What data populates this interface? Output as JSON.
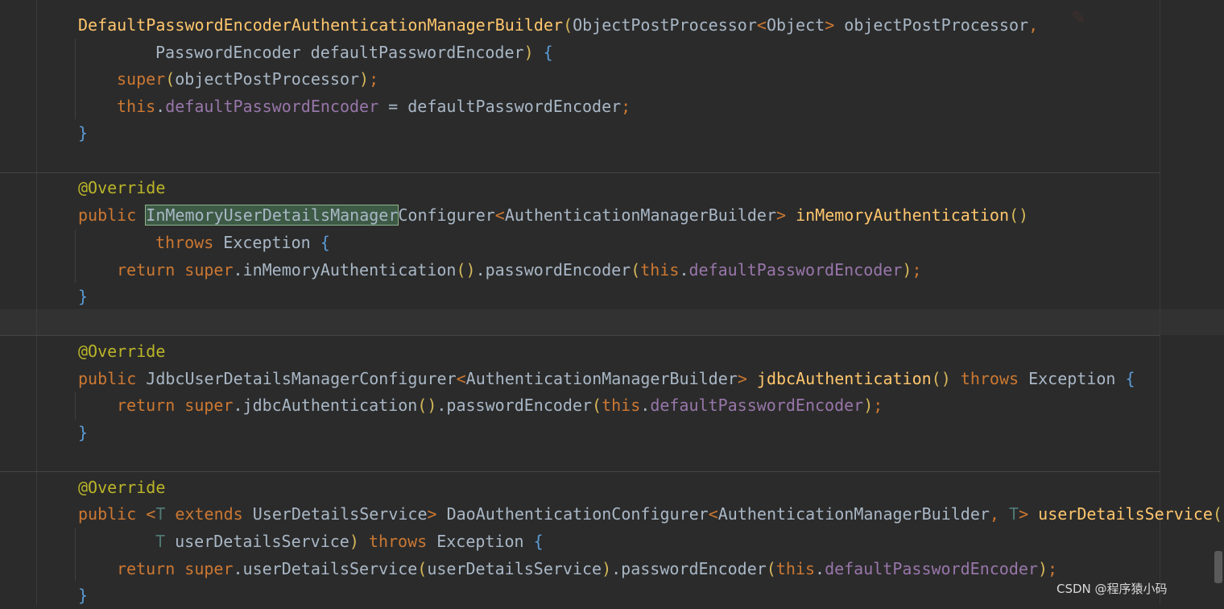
{
  "code": {
    "l0": "DefaultPasswordEncoderAuthenticationManagerBuilder",
    "l0b": "ObjectPostProcessor",
    "l0c": "Object",
    "l0d": " objectPostProcessor",
    "l1": "PasswordEncoder defaultPasswordEncoder",
    "l2a": "super",
    "l2b": "objectPostProcessor",
    "l3a": "this",
    "l3b": "defaultPasswordEncoder",
    "l3c": " = defaultPasswordEncoder",
    "ann": "@Override",
    "pub": "public ",
    "imType": "InMemoryUserDetailsManager",
    "imType2": "Configurer",
    "amb": "AuthenticationManagerBuilder",
    "imFn": "inMemoryAuthentication",
    "throws": "throws",
    "exc": " Exception ",
    "ret": "return ",
    "sup": "super",
    "imCall": ".inMemoryAuthentication",
    "pe": ".passwordEncoder",
    "thisKw": "this",
    "dpe": "defaultPasswordEncoder",
    "jdbcType": "JdbcUserDetailsManagerConfigurer",
    "jdbcFn": "jdbcAuthentication",
    "jdbcCall": ".jdbcAuthentication",
    "tParam": "T",
    "extends": " extends ",
    "uds": "UserDetailsService",
    "dao": " DaoAuthenticationConfigurer",
    "udsFn": "userDetailsService",
    "udsParam": " userDetailsService",
    "udsCall": ".userDetailsService",
    "udsArg": "userDetailsService"
  },
  "watermark": "CSDN @程序猿小码"
}
